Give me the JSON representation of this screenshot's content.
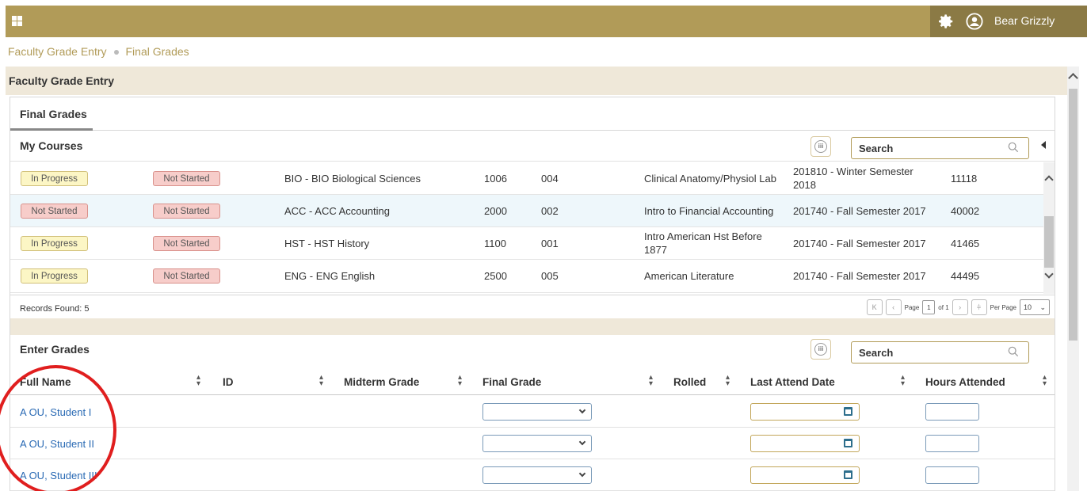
{
  "header": {
    "user_name": "Bear Grizzly",
    "bar_color": "#b19b58",
    "user_area_color": "#8b7a45"
  },
  "breadcrumb": {
    "items": [
      "Faculty Grade Entry",
      "Final Grades"
    ]
  },
  "page": {
    "title": "Faculty Grade Entry",
    "tab": "Final Grades"
  },
  "courses": {
    "title": "My Courses",
    "search_placeholder": "Search",
    "rows": [
      {
        "status1": "In Progress",
        "status1_type": "progress",
        "status2": "Not Started",
        "subject": "BIO - BIO Biological Sciences",
        "course": "1006",
        "section": "004",
        "title": "Clinical Anatomy/Physiol Lab",
        "term": "201810 - Winter Semester 2018",
        "crn": "11118"
      },
      {
        "status1": "Not Started",
        "status1_type": "notstarted",
        "status2": "Not Started",
        "subject": "ACC - ACC Accounting",
        "course": "2000",
        "section": "002",
        "title": "Intro to Financial Accounting",
        "term": "201740 - Fall Semester 2017",
        "crn": "40002"
      },
      {
        "status1": "In Progress",
        "status1_type": "progress",
        "status2": "Not Started",
        "subject": "HST - HST History",
        "course": "1100",
        "section": "001",
        "title": "Intro American Hst Before 1877",
        "term": "201740 - Fall Semester 2017",
        "crn": "41465"
      },
      {
        "status1": "In Progress",
        "status1_type": "progress",
        "status2": "Not Started",
        "subject": "ENG - ENG English",
        "course": "2500",
        "section": "005",
        "title": "American Literature",
        "term": "201740 - Fall Semester 2017",
        "crn": "44495"
      }
    ],
    "records_found": "Records Found: 5",
    "pager": {
      "page_label": "Page",
      "page": "1",
      "of_label": "of 1",
      "per_page_label": "Per Page",
      "per_page": "10"
    }
  },
  "grades": {
    "title": "Enter Grades",
    "search_placeholder": "Search",
    "columns": [
      "Full Name",
      "ID",
      "Midterm Grade",
      "Final Grade",
      "Rolled",
      "Last Attend Date",
      "Hours Attended"
    ],
    "students": [
      "A OU, Student I",
      "A OU, Student II",
      "A OU, Student III"
    ]
  },
  "annotation": {
    "circle_color": "#e01e1e"
  }
}
